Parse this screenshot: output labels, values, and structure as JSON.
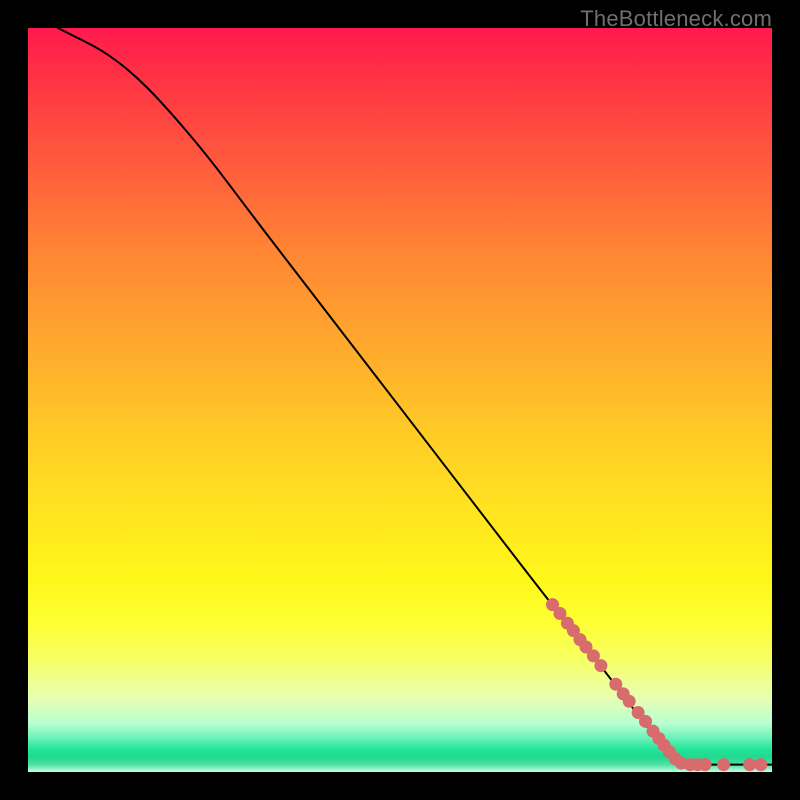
{
  "watermark": "TheBottleneck.com",
  "colors": {
    "dot": "#d86b6b",
    "curve": "#000000",
    "frame": "#000000"
  },
  "chart_data": {
    "type": "line",
    "title": "",
    "xlabel": "",
    "ylabel": "",
    "xlim": [
      0,
      100
    ],
    "ylim": [
      0,
      100
    ],
    "grid": false,
    "curve": [
      {
        "x": 4,
        "y": 100
      },
      {
        "x": 6,
        "y": 99
      },
      {
        "x": 10,
        "y": 97
      },
      {
        "x": 14,
        "y": 94
      },
      {
        "x": 18,
        "y": 90
      },
      {
        "x": 24,
        "y": 83
      },
      {
        "x": 30,
        "y": 75
      },
      {
        "x": 40,
        "y": 62
      },
      {
        "x": 50,
        "y": 49
      },
      {
        "x": 60,
        "y": 36
      },
      {
        "x": 70,
        "y": 23
      },
      {
        "x": 78,
        "y": 13
      },
      {
        "x": 84,
        "y": 5
      },
      {
        "x": 87,
        "y": 2
      },
      {
        "x": 88,
        "y": 1
      },
      {
        "x": 92,
        "y": 1
      },
      {
        "x": 96,
        "y": 1
      },
      {
        "x": 100,
        "y": 1
      }
    ],
    "scatter_on_curve": [
      {
        "x": 70.5,
        "y": 22.5
      },
      {
        "x": 71.5,
        "y": 21.3
      },
      {
        "x": 72.5,
        "y": 20.0
      },
      {
        "x": 73.3,
        "y": 19.0
      },
      {
        "x": 74.2,
        "y": 17.8
      },
      {
        "x": 75.0,
        "y": 16.8
      },
      {
        "x": 76.0,
        "y": 15.6
      },
      {
        "x": 77.0,
        "y": 14.3
      },
      {
        "x": 79.0,
        "y": 11.8
      },
      {
        "x": 80.0,
        "y": 10.5
      },
      {
        "x": 80.8,
        "y": 9.5
      },
      {
        "x": 82.0,
        "y": 8.0
      },
      {
        "x": 83.0,
        "y": 6.8
      },
      {
        "x": 84.0,
        "y": 5.5
      },
      {
        "x": 84.8,
        "y": 4.5
      },
      {
        "x": 85.5,
        "y": 3.6
      },
      {
        "x": 86.2,
        "y": 2.7
      },
      {
        "x": 87.0,
        "y": 1.8
      },
      {
        "x": 87.8,
        "y": 1.2
      },
      {
        "x": 89.0,
        "y": 1.0
      },
      {
        "x": 90.0,
        "y": 1.0
      },
      {
        "x": 91.0,
        "y": 1.0
      },
      {
        "x": 93.5,
        "y": 1.0
      },
      {
        "x": 97.0,
        "y": 1.0
      },
      {
        "x": 98.5,
        "y": 1.0
      }
    ]
  }
}
